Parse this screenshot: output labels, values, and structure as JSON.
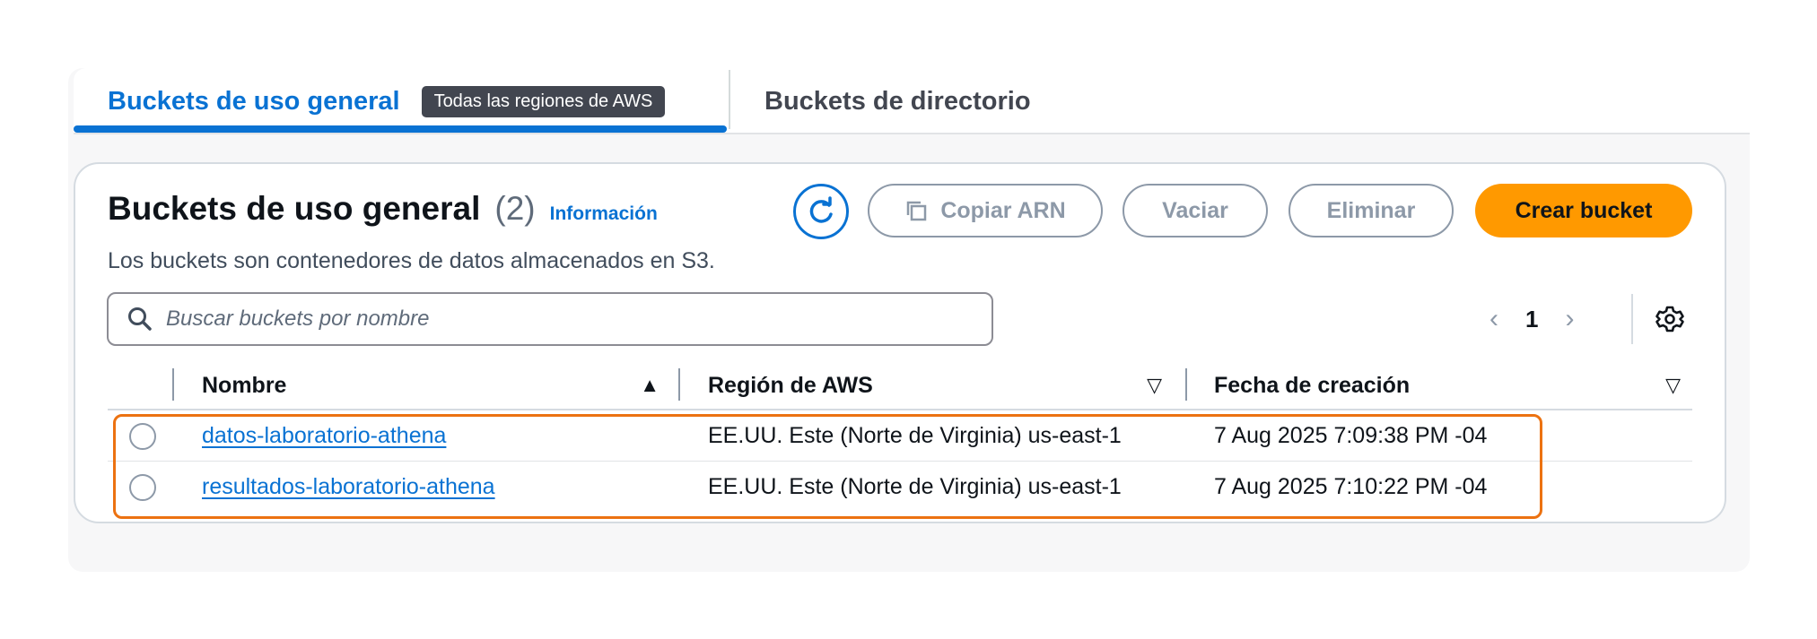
{
  "tabs": {
    "active_label": "Buckets de uso general",
    "active_badge": "Todas las regiones de AWS",
    "inactive_label": "Buckets de directorio"
  },
  "card": {
    "title": "Buckets de uso general",
    "count": "(2)",
    "info_link": "Información",
    "description": "Los buckets son contenedores de datos almacenados en S3."
  },
  "actions": {
    "refresh_icon": "refresh-icon",
    "copy_arn": "Copiar ARN",
    "empty": "Vaciar",
    "delete": "Eliminar",
    "create": "Crear bucket"
  },
  "search": {
    "placeholder": "Buscar buckets por nombre",
    "value": ""
  },
  "pagination": {
    "prev": "‹",
    "page": "1",
    "next": "›",
    "settings_icon": "gear-icon"
  },
  "table": {
    "columns": [
      "Nombre",
      "Región de AWS",
      "Fecha de creación"
    ],
    "sort": {
      "Nombre": "▲",
      "Región de AWS": "▽",
      "Fecha de creación": "▽"
    },
    "rows": [
      {
        "name": "datos-laboratorio-athena",
        "region": "EE.UU. Este (Norte de Virginia) us-east-1",
        "created": "7 Aug 2025 7:09:38 PM -04"
      },
      {
        "name": "resultados-laboratorio-athena",
        "region": "EE.UU. Este (Norte de Virginia) us-east-1",
        "created": "7 Aug 2025 7:10:22 PM -04"
      }
    ]
  },
  "colors": {
    "accent": "#0972d3",
    "primary_button": "#ff9900",
    "highlight": "#ec7211",
    "badge": "#424650"
  }
}
